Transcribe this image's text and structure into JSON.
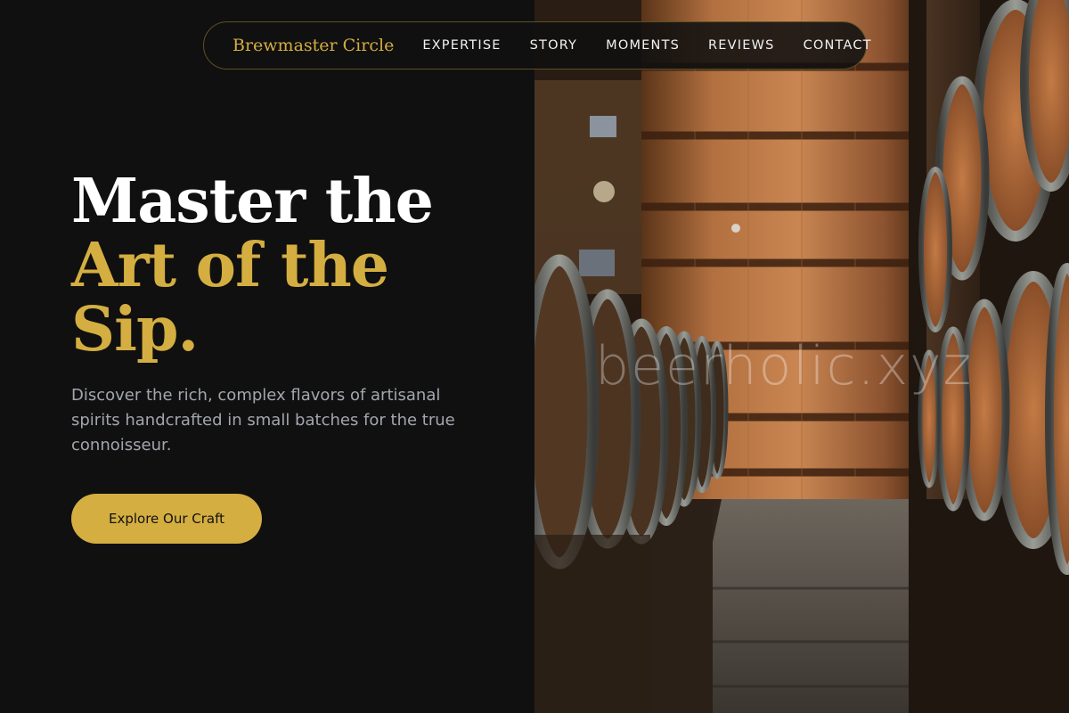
{
  "nav": {
    "brand": "Brewmaster Circle",
    "links": [
      "EXPERTISE",
      "STORY",
      "MOMENTS",
      "REVIEWS",
      "CONTACT"
    ]
  },
  "hero": {
    "title_line1": "Master the",
    "title_line2": "Art of the",
    "title_line3": "Sip.",
    "description": "Discover the rich, complex flavors of artisanal spirits handcrafted in small batches for the true connoisseur.",
    "cta_label": "Explore Our Craft"
  },
  "image": {
    "watermark": "beerholic.xyz",
    "subject": "barrel-cellar-photo"
  },
  "colors": {
    "background": "#101010",
    "accent": "#d4ae41",
    "heading": "#ffffff",
    "body_text": "#a3a6ad",
    "nav_border": "#5d4f26"
  }
}
